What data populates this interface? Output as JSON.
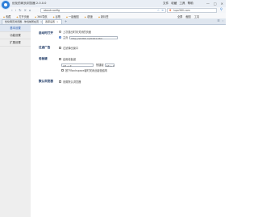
{
  "window": {
    "title": "优化的网页浏览器 2.0.0.0",
    "menus": [
      "文件",
      "收藏",
      "工具",
      "帮助"
    ],
    "controls": [
      "—",
      "□",
      "✕"
    ]
  },
  "addressbar": {
    "url": "about:config",
    "search_engine": "S",
    "search_text": "lupo360.com"
  },
  "bookmarks": {
    "items": [
      "收藏",
      "打开页面",
      "360导航",
      "谷歌",
      "一键截图",
      "i提速",
      "新标签"
    ],
    "right": [
      "全屏",
      "截图",
      "工具"
    ]
  },
  "tabs": [
    {
      "label": "优化网页浏览器 - 你当前所在页"
    },
    {
      "label": "选项设置"
    }
  ],
  "sidenav": {
    "items": [
      {
        "label": "基本设置"
      },
      {
        "label": "功能设置"
      },
      {
        "label": "扩展设置"
      }
    ]
  },
  "settings": {
    "startup": {
      "label": "启动时打开",
      "option1": "上次退出时未关闭的页面",
      "option2_prefix": "主页",
      "homepage": "http://sh360.n1/0101.htm"
    },
    "adblock": {
      "label": "过滤广告",
      "option": "过滤弹出窗口"
    },
    "bosskey": {
      "label": "老板键",
      "option": "启用老板键",
      "key": "Alt + Z",
      "shortcut_label": "快捷键",
      "shortcut_value": "Alt + X",
      "hint": "按下Backspace键时关闭此键值结构"
    },
    "default_browser": {
      "label": "默认浏览器",
      "option": "设置默认浏览器"
    }
  }
}
